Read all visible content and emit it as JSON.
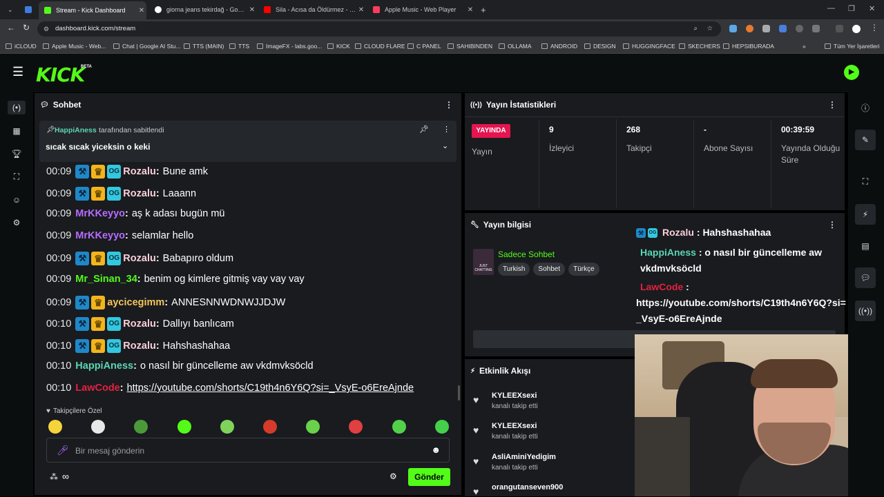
{
  "browser": {
    "tabs": [
      {
        "title": "Stream - Kick Dashboard",
        "color": "#53fc18",
        "active": true
      },
      {
        "title": "giorna jeans tekirdağ - Google'd",
        "color": "#ffffff",
        "active": false
      },
      {
        "title": "Sila - Acısa da Öldürmez - YouT",
        "color": "#ff0000",
        "active": false
      },
      {
        "title": "Apple Music - Web Player",
        "color": "#fa3c5a",
        "active": false
      }
    ],
    "url": "dashboard.kick.com/stream",
    "bookmarks": [
      "iCLOUD",
      "Apple Music - Web...",
      "Chat | Google AI Stu...",
      "TTS (MAIN)",
      "TTS",
      "ImageFX - labs.goo...",
      "KICK",
      "CLOUD FLARE",
      "C PANEL",
      "SAHIBINDEN",
      "OLLAMA",
      "ANDROID",
      "DESIGN",
      "HUGGINGFACE",
      "SKECHERS",
      "HEPSIBURADA"
    ],
    "bookmarks_more": "»",
    "all_bookmarks": "Tüm Yer İşaretleri"
  },
  "header": {
    "logo": "KICK",
    "beta": "BETA"
  },
  "chat": {
    "title": "Sohbet",
    "pinned_by_user": "HappiAness",
    "pinned_by_suffix": "tarafından sabitlendi",
    "pinned_text": "sıcak sıcak yiceksin o keki",
    "messages": [
      {
        "time": "00:09",
        "user": "Rozalu",
        "color": "#fbcfd8",
        "text": "Bune amk",
        "badges": 3
      },
      {
        "time": "00:09",
        "user": "Rozalu",
        "color": "#fbcfd8",
        "text": "Laaann",
        "badges": 3
      },
      {
        "time": "00:09",
        "user": "MrKKeyyo",
        "color": "#b66dff",
        "text": "aş k adası bugün mü",
        "badges": 0
      },
      {
        "time": "00:09",
        "user": "MrKKeyyo",
        "color": "#b66dff",
        "text": "selamlar hello",
        "badges": 0
      },
      {
        "time": "00:09",
        "user": "Rozalu",
        "color": "#fbcfd8",
        "text": "Babapıro oldum",
        "badges": 3
      },
      {
        "time": "00:09",
        "user": "Mr_Sinan_34",
        "color": "#53fc18",
        "text": "benim og kimlere gitmiş vay vay vay",
        "badges": 0
      },
      {
        "time": "00:09",
        "user": "aycicegimm",
        "color": "#f5c65b",
        "text": "ANNESNNWDNWJJDJW",
        "badges": 2
      },
      {
        "time": "00:10",
        "user": "Rozalu",
        "color": "#fbcfd8",
        "text": "Dallıyı banlıcam",
        "badges": 3
      },
      {
        "time": "00:10",
        "user": "Rozalu",
        "color": "#fbcfd8",
        "text": "Hahshashahaa",
        "badges": 3
      },
      {
        "time": "00:10",
        "user": "HappiAness",
        "color": "#5bd6b4",
        "text": "o nasıl bir güncelleme aw vkdmvksöcld",
        "badges": 0
      },
      {
        "time": "00:10",
        "user": "LawCode",
        "color": "#e4213f",
        "text": "https://youtube.com/shorts/C19th4n6Y6Q?si=_VsyE-o6EreAjnde",
        "badges": 0,
        "link": true
      }
    ],
    "emote_section": "Takipçilere Özel",
    "emote_colors": [
      "#f5d33b",
      "#e8e8e8",
      "#4a9a3a",
      "#53fc18",
      "#7fd35a",
      "#d43b2b",
      "#6ad14a",
      "#e04040",
      "#53d04a",
      "#44d04a"
    ],
    "input_placeholder": "Bir mesaj gönderin",
    "send_label": "Gönder",
    "infinity": "∞"
  },
  "stats": {
    "title": "Yayın İstatistikleri",
    "live_badge": "YAYINDA",
    "live_label": "Yayın",
    "cells": [
      {
        "value": "9",
        "label": "İzleyici"
      },
      {
        "value": "268",
        "label": "Takipçi"
      },
      {
        "value": "-",
        "label": "Abone Sayısı"
      },
      {
        "value": "00:39:59",
        "label": "Yayında Olduğu Süre"
      }
    ]
  },
  "info": {
    "title": "Yayın bilgisi",
    "category": "Sadece Sohbet",
    "tags": [
      "Turkish",
      "Sohbet",
      "Türkçe"
    ],
    "thumb_text": "JUST CHATTING"
  },
  "overlay": {
    "line1_user": "Rozalu",
    "line1_text": ": Hahshashahaa",
    "line2_user": "HappiAness",
    "line2_text": ": o nasıl bir güncelleme aw vkdmvksöcld",
    "line3_user": "LawCode",
    "line3_colon": ":",
    "line3_text": "https://youtube.com/shorts/C19th4n6Y6Q?si=_VsyE-o6EreAjnde"
  },
  "activity": {
    "title": "Etkinlik Akışı",
    "items": [
      {
        "name": "KYLEEXsexi",
        "sub": "kanalı takip etti"
      },
      {
        "name": "KYLEEXsexi",
        "sub": "kanalı takip etti"
      },
      {
        "name": "AsliAminiYedigim",
        "sub": "kanalı takip etti"
      },
      {
        "name": "orangutanseven900",
        "sub": ""
      }
    ]
  }
}
